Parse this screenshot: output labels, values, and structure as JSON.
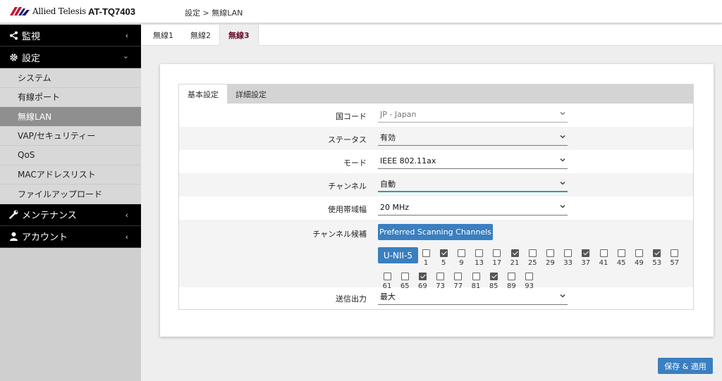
{
  "header": {
    "brand": "Allied Telesis",
    "model": "AT-TQ7403",
    "breadcrumb": "設定 > 無線LAN"
  },
  "sidebar": {
    "groups": [
      {
        "label": "監視",
        "icon": "share-icon",
        "expanded": false
      },
      {
        "label": "設定",
        "icon": "gear-icon",
        "expanded": true
      },
      {
        "label": "メンテナンス",
        "icon": "wrench-icon",
        "expanded": false
      },
      {
        "label": "アカウント",
        "icon": "user-icon",
        "expanded": false
      }
    ],
    "settings_items": [
      {
        "label": "システム"
      },
      {
        "label": "有線ポート"
      },
      {
        "label": "無線LAN",
        "active": true
      },
      {
        "label": "VAP/セキュリティー"
      },
      {
        "label": "QoS"
      },
      {
        "label": "MACアドレスリスト"
      },
      {
        "label": "ファイルアップロード"
      }
    ]
  },
  "top_tabs": [
    "無線1",
    "無線2",
    "無線3"
  ],
  "active_top_tab": "無線3",
  "inner_tabs": [
    "基本設定",
    "詳細設定"
  ],
  "active_inner_tab": "基本設定",
  "form": {
    "country": {
      "label": "国コード",
      "value": "JP - Japan"
    },
    "status": {
      "label": "ステータス",
      "value": "有効"
    },
    "mode": {
      "label": "モード",
      "value": "IEEE 802.11ax"
    },
    "channel": {
      "label": "チャンネル",
      "value": "自動"
    },
    "bandwidth": {
      "label": "使用帯域幅",
      "value": "20 MHz"
    },
    "candidates": {
      "label": "チャンネル候補",
      "preferred_button": "Preferred Scanning Channels",
      "unii_button": "U-NII-5",
      "channels": [
        {
          "n": "1",
          "checked": false
        },
        {
          "n": "5",
          "checked": true
        },
        {
          "n": "9",
          "checked": false
        },
        {
          "n": "13",
          "checked": false
        },
        {
          "n": "17",
          "checked": false
        },
        {
          "n": "21",
          "checked": true
        },
        {
          "n": "25",
          "checked": false
        },
        {
          "n": "29",
          "checked": false
        },
        {
          "n": "33",
          "checked": false
        },
        {
          "n": "37",
          "checked": true
        },
        {
          "n": "41",
          "checked": false
        },
        {
          "n": "45",
          "checked": false
        },
        {
          "n": "49",
          "checked": false
        },
        {
          "n": "53",
          "checked": true
        },
        {
          "n": "57",
          "checked": false
        },
        {
          "n": "61",
          "checked": false
        },
        {
          "n": "65",
          "checked": false
        },
        {
          "n": "69",
          "checked": true
        },
        {
          "n": "73",
          "checked": false
        },
        {
          "n": "77",
          "checked": false
        },
        {
          "n": "81",
          "checked": false
        },
        {
          "n": "85",
          "checked": true
        },
        {
          "n": "89",
          "checked": false
        },
        {
          "n": "93",
          "checked": false
        }
      ]
    },
    "power": {
      "label": "送信出力",
      "value": "最大"
    }
  },
  "save_button": "保存 & 適用",
  "colors": {
    "accent": "#3a7fc0",
    "focus": "#2b9bb4",
    "active_tab_text": "#6a0a2a"
  }
}
